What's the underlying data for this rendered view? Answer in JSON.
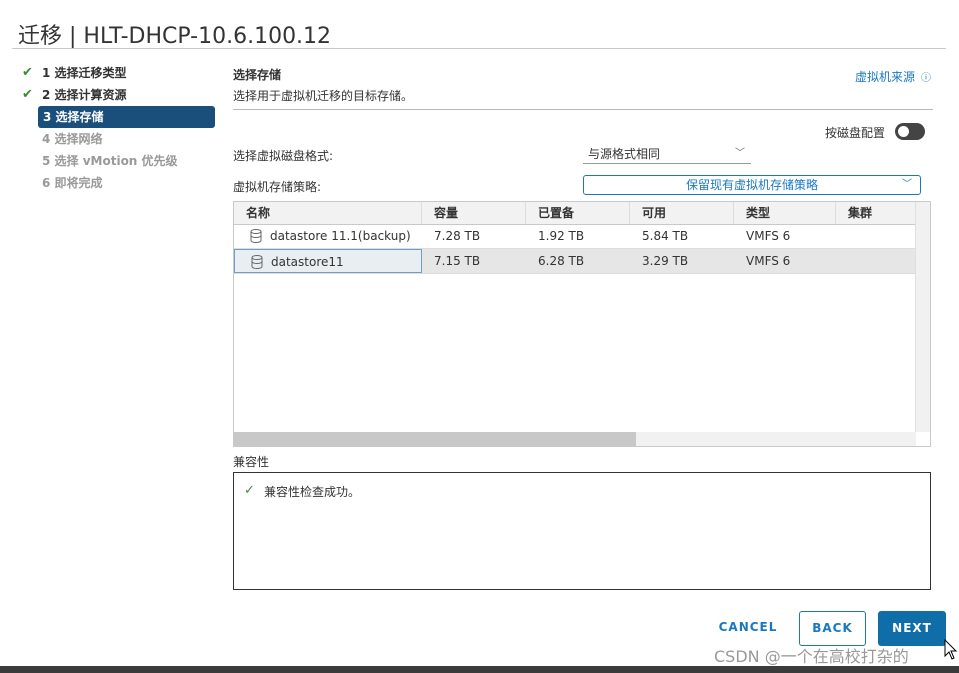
{
  "window": {
    "title": "迁移 | HLT-DHCP-10.6.100.12"
  },
  "steps": [
    {
      "label": "1 选择迁移类型",
      "state": "done"
    },
    {
      "label": "2 选择计算资源",
      "state": "done"
    },
    {
      "label": "3 选择存储",
      "state": "active"
    },
    {
      "label": "4 选择网络",
      "state": "disabled"
    },
    {
      "label": "5 选择 vMotion 优先级",
      "state": "disabled"
    },
    {
      "label": "6 即将完成",
      "state": "disabled"
    }
  ],
  "section": {
    "title": "选择存储",
    "description": "选择用于虚拟机迁移的目标存储。",
    "vm_origin_link": "虚拟机来源",
    "per_disk_toggle_label": "按磁盘配置"
  },
  "form": {
    "disk_format_label": "选择虚拟磁盘格式:",
    "disk_format_value": "与源格式相同",
    "storage_policy_label": "虚拟机存储策略:",
    "storage_policy_value": "保留现有虚拟机存储策略"
  },
  "table": {
    "columns": [
      "名称",
      "容量",
      "已置备",
      "可用",
      "类型",
      "集群"
    ],
    "rows": [
      {
        "name": "datastore 11.1(backup)",
        "capacity": "7.28 TB",
        "provisioned": "1.92 TB",
        "free": "5.84 TB",
        "type": "VMFS 6",
        "cluster": ""
      },
      {
        "name": "datastore11",
        "capacity": "7.15 TB",
        "provisioned": "6.28 TB",
        "free": "3.29 TB",
        "type": "VMFS 6",
        "cluster": "",
        "selected": true
      }
    ]
  },
  "compatibility": {
    "label": "兼容性",
    "message": "兼容性检查成功。"
  },
  "buttons": {
    "cancel": "CANCEL",
    "back": "BACK",
    "next": "NEXT"
  },
  "watermark": "CSDN @一个在高校打杂的",
  "colors": {
    "accent": "#1a78c2",
    "active_step": "#1a4f7b",
    "success": "#3a8a3a",
    "primary_button": "#0f6ea8"
  }
}
